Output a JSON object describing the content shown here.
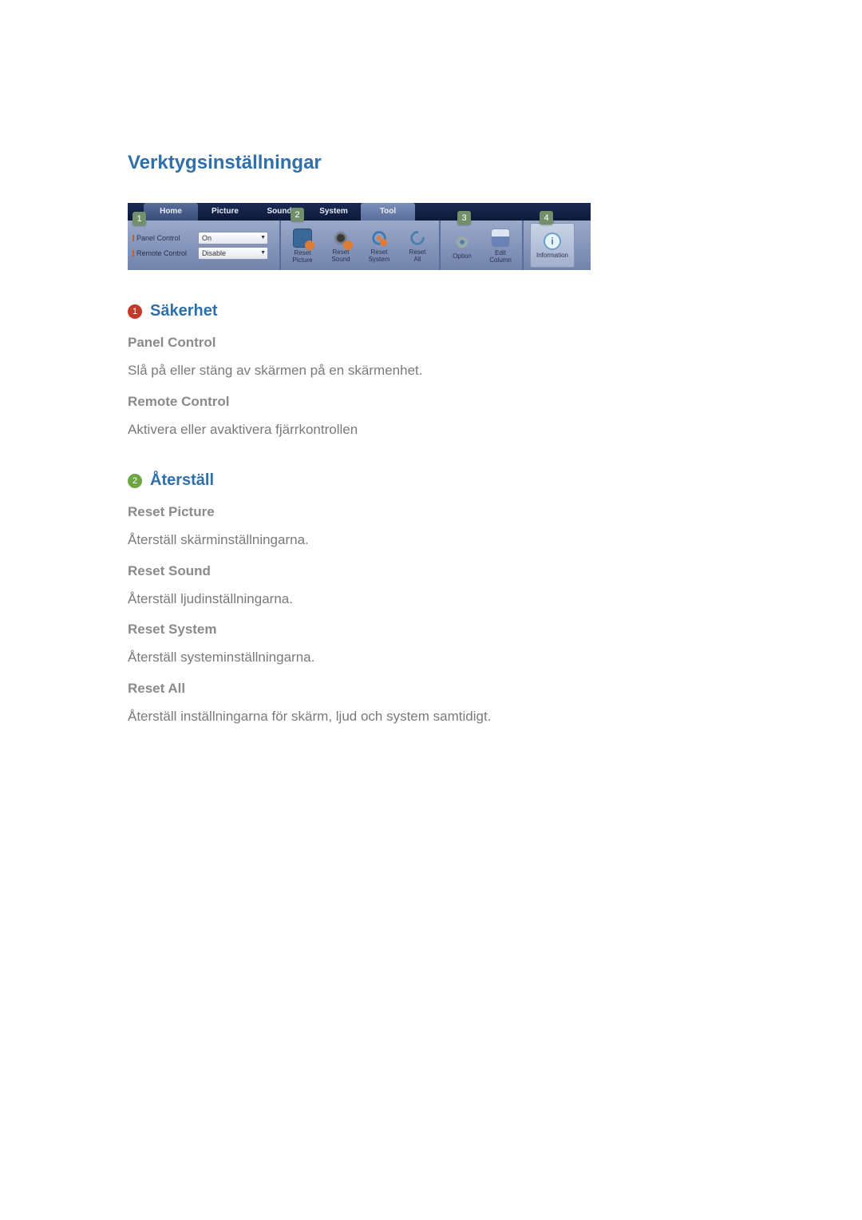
{
  "page_title": "Verktygsinställningar",
  "toolbar": {
    "tabs": {
      "home": "Home",
      "picture": "Picture",
      "sound": "Sound",
      "system": "System",
      "tool": "Tool"
    },
    "section1": {
      "panel_control_label": "Panel Control",
      "panel_control_value": "On",
      "remote_control_label": "Remote Control",
      "remote_control_value": "Disable"
    },
    "buttons": {
      "reset_picture": "Reset\nPicture",
      "reset_sound": "Reset\nSound",
      "reset_system": "Reset\nSystem",
      "reset_all": "Reset\nAll",
      "option": "Option",
      "edit_column": "Edit\nColumn",
      "information": "Information"
    },
    "callouts": {
      "c1": "1",
      "c2": "2",
      "c3": "3",
      "c4": "4"
    }
  },
  "sections": [
    {
      "number": "1",
      "bullet_class": "",
      "title": "Säkerhet",
      "items": [
        {
          "heading": "Panel Control",
          "desc": "Slå på eller stäng av skärmen på en skärmenhet."
        },
        {
          "heading": "Remote Control",
          "desc": "Aktivera eller avaktivera fjärrkontrollen"
        }
      ]
    },
    {
      "number": "2",
      "bullet_class": "green",
      "title": "Återställ",
      "items": [
        {
          "heading": "Reset Picture",
          "desc": "Återställ skärminställningarna."
        },
        {
          "heading": "Reset Sound",
          "desc": "Återställ ljudinställningarna."
        },
        {
          "heading": "Reset System",
          "desc": "Återställ systeminställningarna."
        },
        {
          "heading": "Reset All",
          "desc": "Återställ inställningarna för skärm, ljud och system samtidigt."
        }
      ]
    }
  ]
}
